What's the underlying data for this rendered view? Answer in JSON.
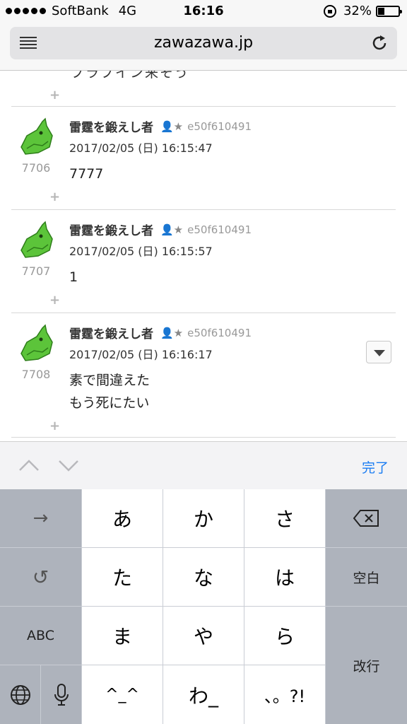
{
  "status_bar": {
    "carrier": "SoftBank",
    "network": "4G",
    "time": "16:16",
    "battery": "32%"
  },
  "browser": {
    "url": "zawazawa.jp"
  },
  "feed": {
    "partial_text": "ブラブイン来そう",
    "comments": [
      {
        "number": "7706",
        "author": "雷霆を鍛えし者",
        "user_badge": "👤★",
        "user_id": "e50f610491",
        "date": "2017/02/05 (日) 16:15:47",
        "lines": [
          "7777"
        ]
      },
      {
        "number": "7707",
        "author": "雷霆を鍛えし者",
        "user_badge": "👤★",
        "user_id": "e50f610491",
        "date": "2017/02/05 (日) 16:15:57",
        "lines": [
          "1"
        ]
      },
      {
        "number": "7708",
        "author": "雷霆を鍛えし者",
        "user_badge": "👤★",
        "user_id": "e50f610491",
        "date": "2017/02/05 (日) 16:16:17",
        "lines": [
          "素で間違えた",
          "もう死にたい"
        ]
      }
    ],
    "plus_symbol": "+"
  },
  "accessory": {
    "done_label": "完了",
    "accent_color": "#1a7cf2"
  },
  "keyboard": {
    "arrow_key": "→",
    "undo_key": "↺",
    "abc_key": "ABC",
    "globe_key": "globe-icon",
    "mic_key": "mic-icon",
    "row1": [
      "あ",
      "か",
      "さ"
    ],
    "row2": [
      "た",
      "な",
      "は"
    ],
    "row3": [
      "ま",
      "や",
      "ら"
    ],
    "row4": [
      "^_^",
      "わ_",
      "、。?!"
    ],
    "delete_key": "delete-icon",
    "space_key": "空白",
    "return_key": "改行"
  }
}
